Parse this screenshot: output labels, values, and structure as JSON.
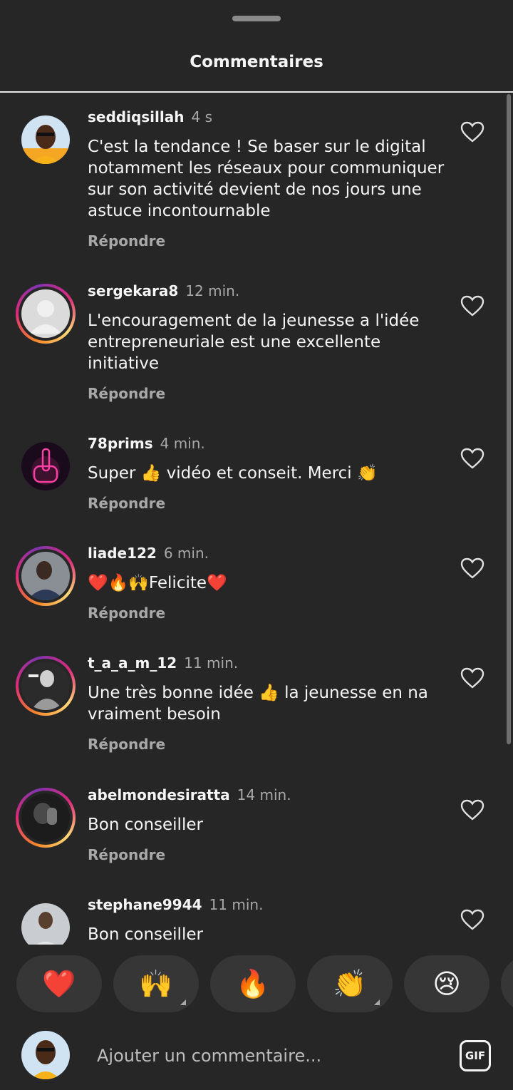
{
  "header": {
    "title": "Commentaires"
  },
  "reply_label": "Répondre",
  "comments": [
    {
      "username": "seddiqsillah",
      "time": "4 s",
      "text": "C'est la tendance ! Se baser sur le digital notamment les réseaux pour communiquer sur son activité devient de nos jours une astuce incontournable",
      "has_story_ring": false,
      "avatar": "profile-photo"
    },
    {
      "username": "sergekara8",
      "time": "12 min.",
      "text": "L'encouragement de la jeunesse a l'idée entrepreneuriale est une excellente initiative",
      "has_story_ring": true,
      "avatar": "default-avatar"
    },
    {
      "username": "78prims",
      "time": "4 min.",
      "text": "Super 👍 vidéo et conseit. Merci 👏",
      "has_story_ring": false,
      "avatar": "neon-hand"
    },
    {
      "username": "liade122",
      "time": "6 min.",
      "text": "❤️🔥🙌Felicite❤️",
      "has_story_ring": true,
      "avatar": "profile-photo"
    },
    {
      "username": "t_a_a_m_12",
      "time": "11 min.",
      "text": "Une très bonne idée 👍 la jeunesse en na vraiment besoin",
      "has_story_ring": true,
      "avatar": "bw-photo"
    },
    {
      "username": "abelmondesiratta",
      "time": "14 min.",
      "text": "Bon conseiller",
      "has_story_ring": true,
      "avatar": "dark-photo"
    },
    {
      "username": "stephane9944",
      "time": "11 min.",
      "text": "Bon conseiller",
      "has_story_ring": false,
      "avatar": "profile-photo"
    }
  ],
  "reactions": [
    {
      "emoji": "❤️",
      "has_variants": false
    },
    {
      "emoji": "🙌",
      "has_variants": true
    },
    {
      "emoji": "🔥",
      "has_variants": false
    },
    {
      "emoji": "👏",
      "has_variants": true
    },
    {
      "emoji": "😢",
      "has_variants": false
    }
  ],
  "composer": {
    "placeholder": "Ajouter un commentaire...",
    "gif_label": "GIF"
  },
  "icons": {
    "like": "heart-outline-icon",
    "gif": "gif-icon"
  },
  "colors": {
    "background": "#262626",
    "secondary_text": "#a8a8a8",
    "reaction_pill": "#363636",
    "story_ring": [
      "#f58529",
      "#dd2a7b",
      "#8134af"
    ]
  }
}
